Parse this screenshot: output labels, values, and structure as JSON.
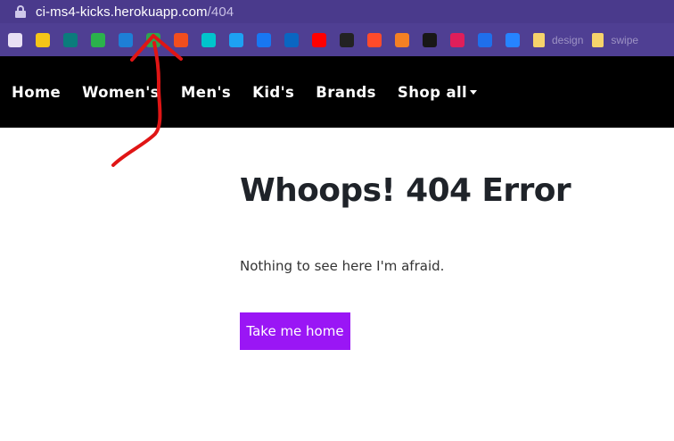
{
  "browser": {
    "url_host": "ci-ms4-kicks.herokuapp.com",
    "url_path": "/404",
    "bookmarks": [
      {
        "icon": "ublock-icon",
        "color": "#e8e0f5"
      },
      {
        "icon": "mailchimp-icon",
        "color": "#f5c518"
      },
      {
        "icon": "sharepoint-icon",
        "color": "#0b7c7c"
      },
      {
        "icon": "feedly-icon",
        "color": "#2bb24c"
      },
      {
        "icon": "trello-icon",
        "color": "#1e7fd6"
      },
      {
        "icon": "github-desktop-icon",
        "color": "#2ea44f"
      },
      {
        "icon": "figma-icon",
        "color": "#f24e1e"
      },
      {
        "icon": "canva-icon",
        "color": "#00c4cc"
      },
      {
        "icon": "twitter-icon",
        "color": "#1da1f2"
      },
      {
        "icon": "facebook-icon",
        "color": "#1877f2"
      },
      {
        "icon": "linkedin-icon",
        "color": "#0a66c2"
      },
      {
        "icon": "youtube-icon",
        "color": "#ff0000"
      },
      {
        "icon": "crown-icon",
        "color": "#222222"
      },
      {
        "icon": "opera-icon",
        "color": "#ff4b2b"
      },
      {
        "icon": "stackoverflow-icon",
        "color": "#f48024"
      },
      {
        "icon": "github-icon",
        "color": "#181717"
      },
      {
        "icon": "slack-icon",
        "color": "#e01e5a"
      },
      {
        "icon": "cc-icon",
        "color": "#1f6feb"
      },
      {
        "icon": "jira-icon",
        "color": "#2684ff"
      }
    ],
    "folders": [
      {
        "label": "design"
      },
      {
        "label": "swipe"
      }
    ]
  },
  "nav": {
    "items": [
      "Home",
      "Women's",
      "Men's",
      "Kid's",
      "Brands"
    ],
    "shop_all": "Shop all"
  },
  "content": {
    "title": "Whoops! 404 Error",
    "subtitle": "Nothing to see here I'm afraid.",
    "button_label": "Take me home",
    "button_color": "#9a16f5"
  },
  "annotation": {
    "color": "#e01515"
  }
}
